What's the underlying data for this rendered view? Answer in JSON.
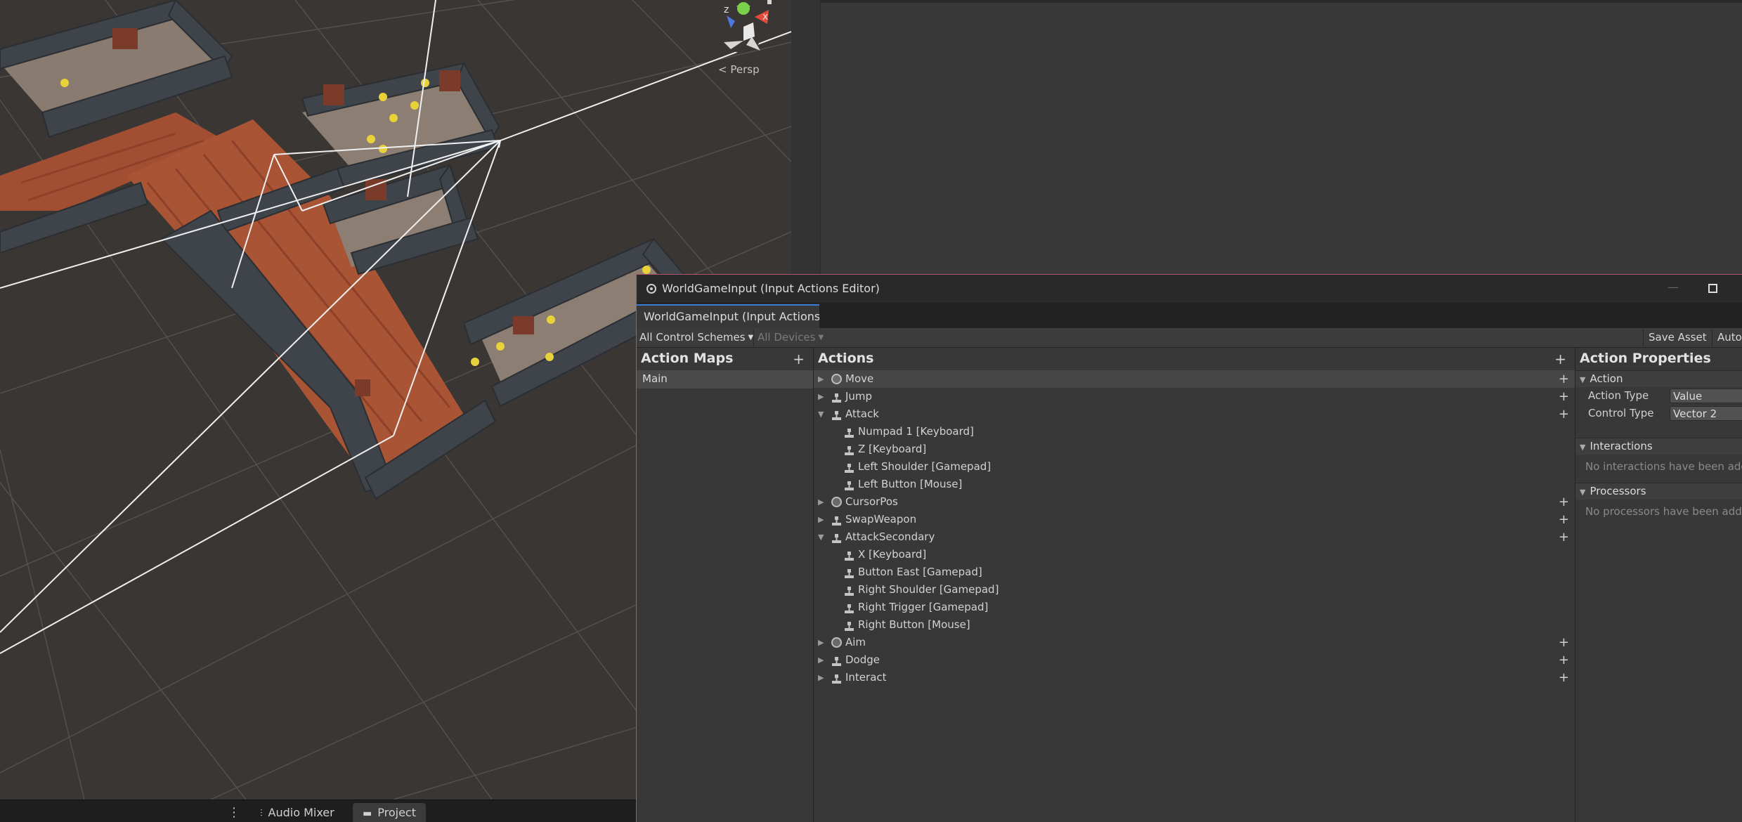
{
  "scene": {
    "view_mode": "Persp",
    "gizmo_axes": {
      "x": "x",
      "z": "z"
    }
  },
  "bottom_tabs": {
    "items": [
      {
        "label": "Audio Mixer",
        "icon": "audio-mixer-icon"
      },
      {
        "label": "Project",
        "icon": "folder-icon"
      }
    ]
  },
  "editor": {
    "window_title": "WorldGameInput (Input Actions Editor)",
    "tab_label": "WorldGameInput (Input Actions E",
    "toolbar": {
      "control_schemes": "All Control Schemes",
      "devices": "All Devices",
      "save_asset": "Save Asset",
      "auto_save": "Auto-Save"
    },
    "action_maps": {
      "title": "Action Maps",
      "items": [
        "Main"
      ]
    },
    "actions": {
      "title": "Actions",
      "rows": [
        {
          "label": "Move",
          "kind": "action",
          "icon": "value-circle-icon",
          "expanded": false,
          "selected": true
        },
        {
          "label": "Jump",
          "kind": "action",
          "icon": "button-action-icon",
          "expanded": false
        },
        {
          "label": "Attack",
          "kind": "action",
          "icon": "button-action-icon",
          "expanded": true
        },
        {
          "label": "Numpad 1 [Keyboard]",
          "kind": "binding"
        },
        {
          "label": "Z [Keyboard]",
          "kind": "binding"
        },
        {
          "label": "Left Shoulder [Gamepad]",
          "kind": "binding"
        },
        {
          "label": "Left Button [Mouse]",
          "kind": "binding"
        },
        {
          "label": "CursorPos",
          "kind": "action",
          "icon": "value-circle-icon",
          "expanded": false
        },
        {
          "label": "SwapWeapon",
          "kind": "action",
          "icon": "button-action-icon",
          "expanded": false
        },
        {
          "label": "AttackSecondary",
          "kind": "action",
          "icon": "button-action-icon",
          "expanded": true
        },
        {
          "label": "X [Keyboard]",
          "kind": "binding"
        },
        {
          "label": "Button East [Gamepad]",
          "kind": "binding"
        },
        {
          "label": "Right Shoulder [Gamepad]",
          "kind": "binding"
        },
        {
          "label": "Right Trigger [Gamepad]",
          "kind": "binding"
        },
        {
          "label": "Right Button [Mouse]",
          "kind": "binding"
        },
        {
          "label": "Aim",
          "kind": "action",
          "icon": "value-circle-icon",
          "expanded": false
        },
        {
          "label": "Dodge",
          "kind": "action",
          "icon": "button-action-icon",
          "expanded": false
        },
        {
          "label": "Interact",
          "kind": "action",
          "icon": "button-action-icon",
          "expanded": false
        }
      ]
    },
    "properties": {
      "title": "Action Properties",
      "action_section": "Action",
      "action_type_label": "Action Type",
      "action_type_value": "Value",
      "control_type_label": "Control Type",
      "control_type_value": "Vector 2",
      "interactions_section": "Interactions",
      "interactions_note": "No interactions have been added.",
      "processors_section": "Processors",
      "processors_note": "No processors have been added."
    }
  }
}
